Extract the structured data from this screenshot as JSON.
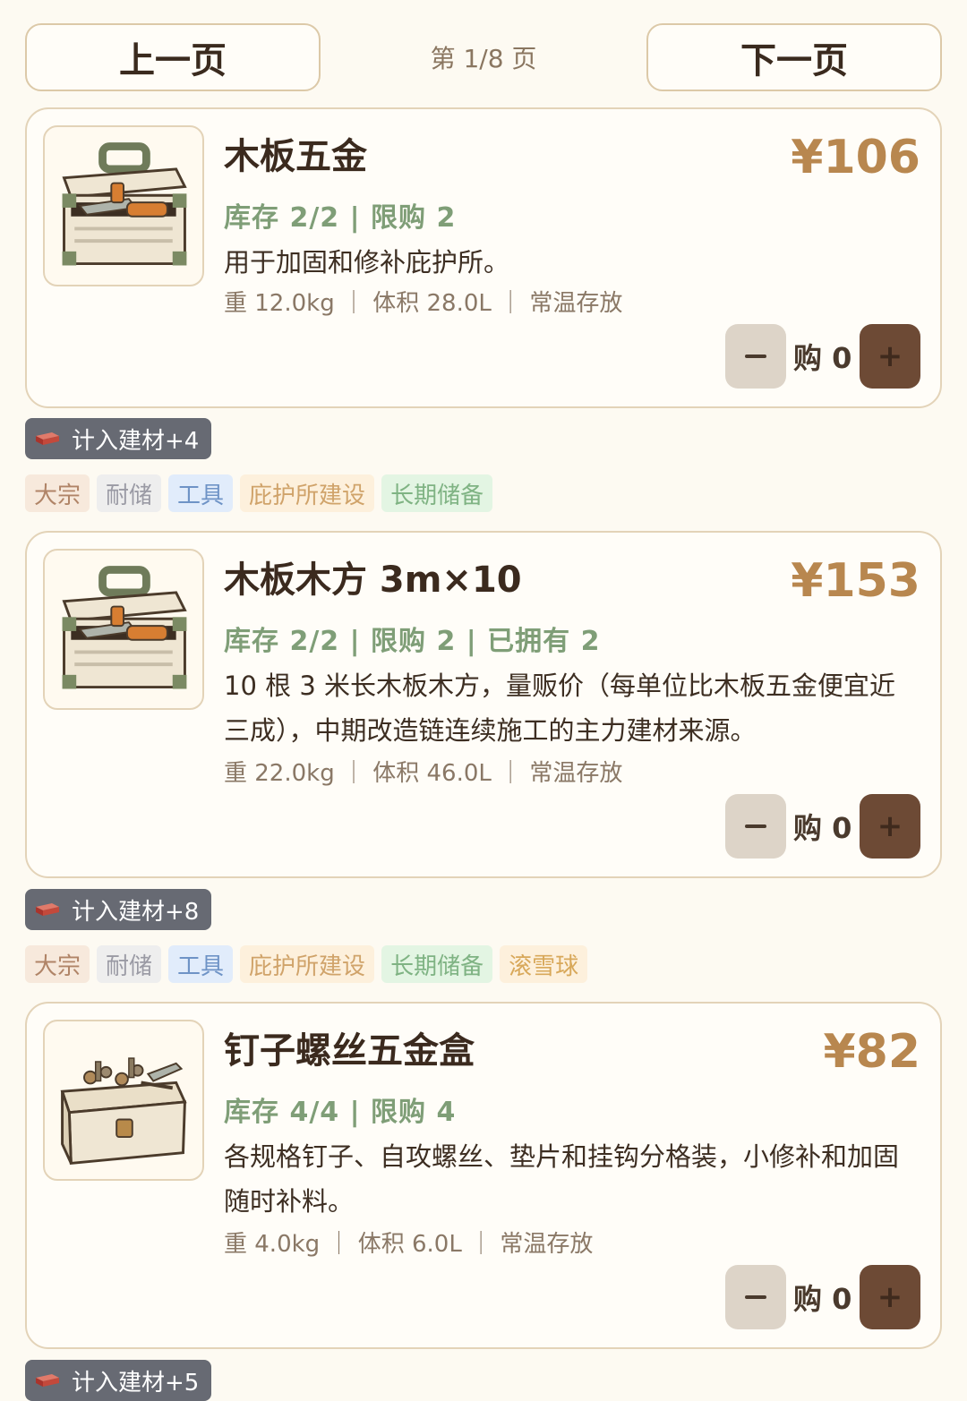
{
  "pager": {
    "prev_label": "上一页",
    "next_label": "下一页",
    "page_label": "第 1/8 页"
  },
  "items": [
    {
      "name": "木板五金",
      "price": "¥106",
      "stock_line": "库存 2/2 | 限购 2",
      "description": "用于加固和修补庇护所。",
      "meta": "重 12.0kg ｜ 体积 28.0L ｜ 常温存放",
      "qty_label": "购 0",
      "icon": "toolbox-icon",
      "credit": "计入建材+4",
      "tags": [
        "大宗",
        "耐储",
        "工具",
        "庇护所建设",
        "长期储备"
      ]
    },
    {
      "name": "木板木方 3m×10",
      "price": "¥153",
      "stock_line": "库存 2/2 | 限购 2 | 已拥有 2",
      "description": "10 根 3 米长木板木方，量贩价（每单位比木板五金便宜近三成），中期改造链连续施工的主力建材来源。",
      "meta": "重 22.0kg ｜ 体积 46.0L ｜ 常温存放",
      "qty_label": "购 0",
      "icon": "toolbox-icon",
      "credit": "计入建材+8",
      "tags": [
        "大宗",
        "耐储",
        "工具",
        "庇护所建设",
        "长期储备",
        "滚雪球"
      ]
    },
    {
      "name": "钉子螺丝五金盒",
      "price": "¥82",
      "stock_line": "库存 4/4 | 限购 4",
      "description": "各规格钉子、自攻螺丝、垫片和挂钩分格装，小修补和加固随时补料。",
      "meta": "重 4.0kg ｜ 体积 6.0L ｜ 常温存放",
      "qty_label": "购 0",
      "icon": "hardware-box-icon",
      "credit": "计入建材+5",
      "tags": []
    }
  ]
}
